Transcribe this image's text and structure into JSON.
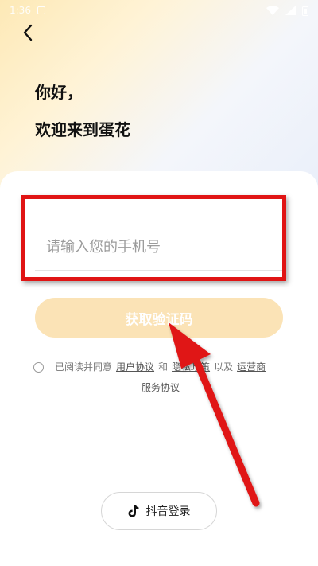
{
  "status_bar": {
    "time": "1:36"
  },
  "header": {
    "greeting_line1": "你好，",
    "greeting_line2": "欢迎来到蛋花"
  },
  "login": {
    "phone_placeholder": "请输入您的手机号",
    "get_code_label": "获取验证码"
  },
  "agreement": {
    "prefix": "已阅读并同意",
    "user_agreement": "用户协议",
    "and": "和",
    "privacy_policy": "隐私政策",
    "also": "以及",
    "operator": "运营商",
    "service_agreement": "服务协议"
  },
  "alt_login": {
    "douyin_label": "抖音登录"
  },
  "colors": {
    "accent_light": "#fbe3b6",
    "annotation_red": "#e01414"
  }
}
